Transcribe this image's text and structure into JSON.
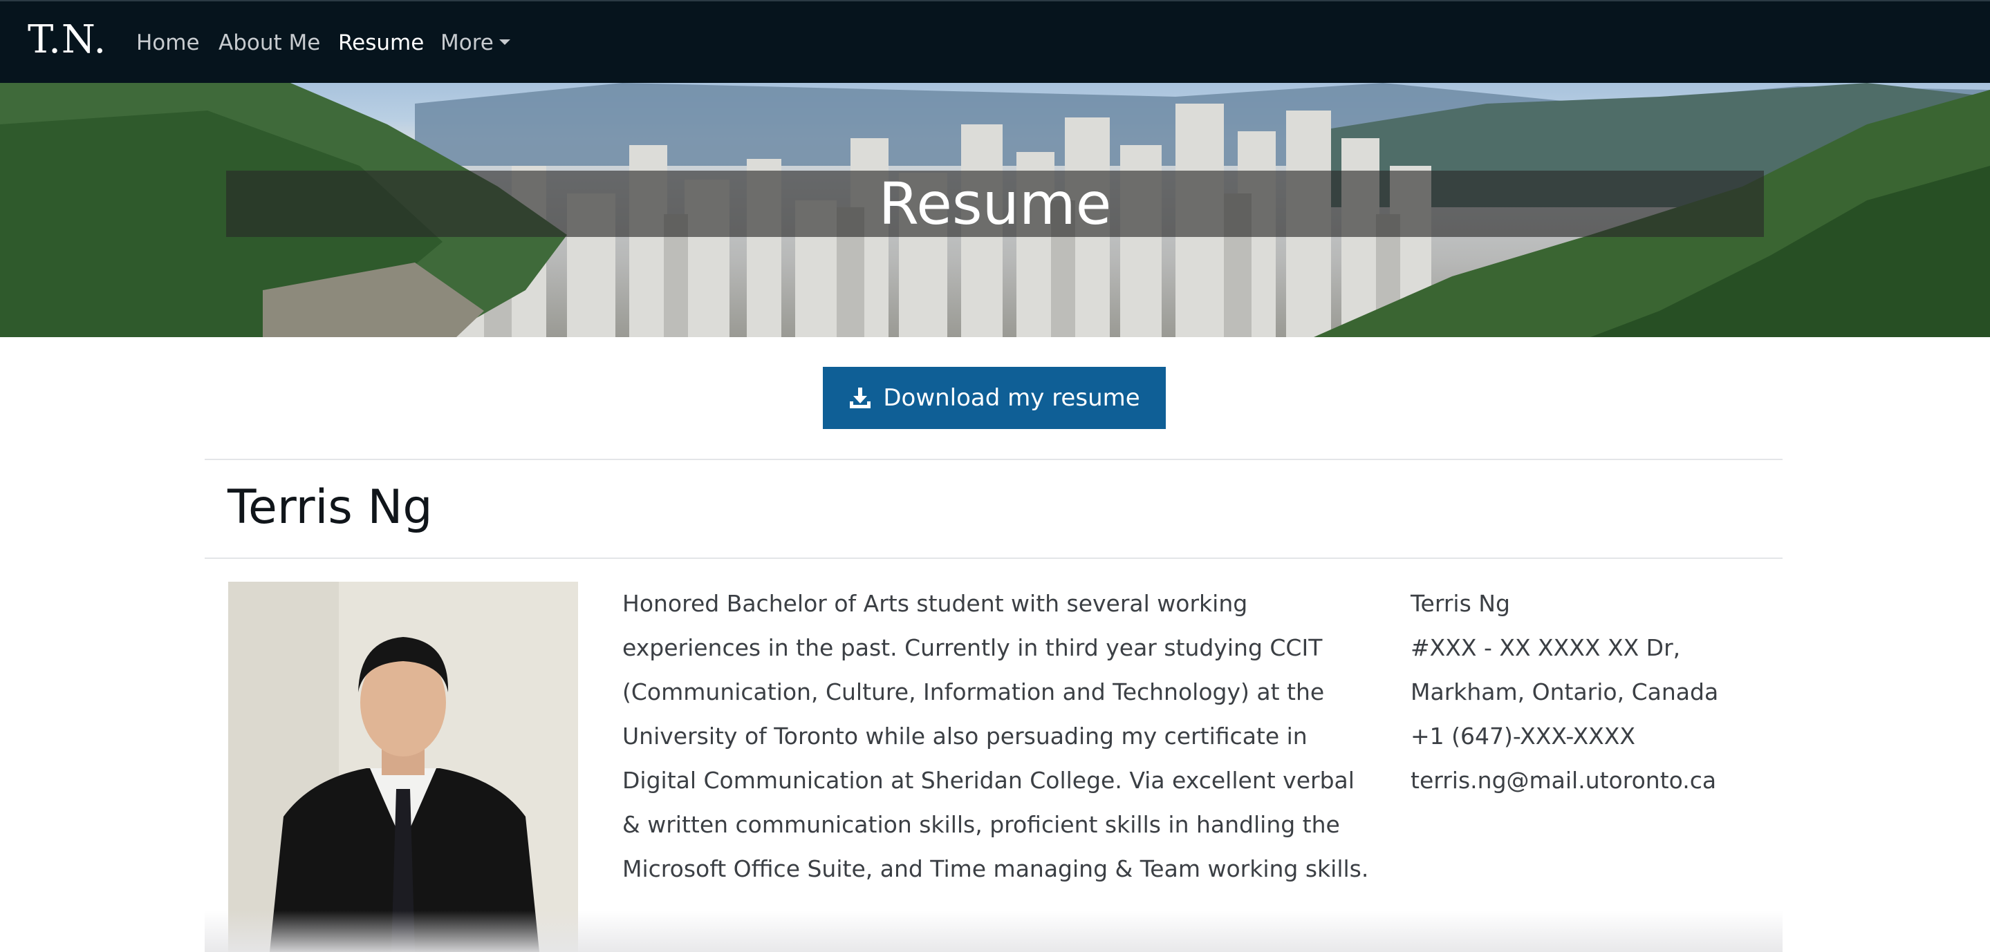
{
  "nav": {
    "brand": "T.N.",
    "links": [
      {
        "label": "Home"
      },
      {
        "label": "About Me"
      },
      {
        "label": "Resume"
      },
      {
        "label": "More"
      }
    ],
    "active": "Resume"
  },
  "hero": {
    "title": "Resume"
  },
  "download": {
    "label": "Download my resume",
    "icon": "download-icon",
    "color": "#0f5f96"
  },
  "profile": {
    "name": "Terris Ng",
    "bio": "Honored Bachelor of Arts student with several working experiences in the past. Currently in third year studying CCIT (Communication, Culture, Information and Technology) at the University of Toronto while also persuading my certificate in Digital Communication at Sheridan College. Via excellent verbal & written communication skills, proficient skills in handling the Microsoft Office Suite, and Time managing & Team working skills.",
    "contact": {
      "name": "Terris Ng",
      "address1": "#XXX - XX XXXX XX Dr,",
      "address2": "Markham, Ontario, Canada",
      "phone": "+1 (647)-XXX-XXXX",
      "email": "terris.ng@mail.utoronto.ca"
    }
  },
  "colors": {
    "navbar": "#06141d",
    "button": "#0f5f96"
  }
}
